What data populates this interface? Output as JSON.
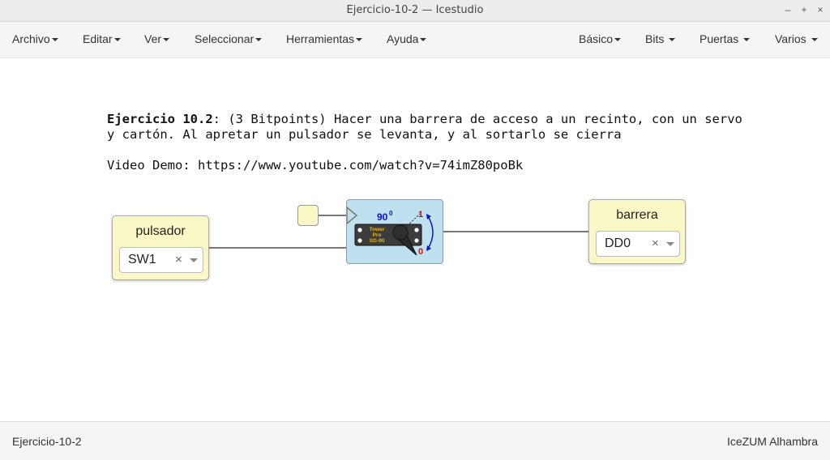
{
  "window": {
    "title": "Ejercicio-10-2 — Icestudio"
  },
  "menu": {
    "left": [
      "Archivo",
      "Editar",
      "Ver",
      "Seleccionar",
      "Herramientas",
      "Ayuda"
    ],
    "right": [
      "Básico",
      "Bits",
      "Puertas",
      "Varios"
    ]
  },
  "info": {
    "title_bold": "Ejercicio 10.2",
    "title_rest": ": (3 Bitpoints) Hacer una barrera de acceso a un recinto, con un servo\ny cartón. Al apretar un pulsador se levanta, y al sortarlo se cierra",
    "video": "Video Demo: https://www.youtube.com/watch?v=74imZ80poBk"
  },
  "blocks": {
    "input": {
      "label": "pulsador",
      "pin": "SW1"
    },
    "output": {
      "label": "barrera",
      "pin": "DD0"
    }
  },
  "servo": {
    "angle": "90",
    "degree_sign": "0",
    "high": "1",
    "low": "0",
    "brand_lines": [
      "Tower",
      "Pro",
      "SG-90"
    ]
  },
  "statusbar": {
    "left": "Ejercicio-10-2",
    "right": "IceZUM Alhambra"
  },
  "colors": {
    "block_bg": "#fbf8c8",
    "servo_bg": "#bfe0ee",
    "wire": "#777777",
    "angle_blue": "#1010cc",
    "red": "#ee0000",
    "brand_yellow": "#e8b800"
  },
  "icons": {
    "minimize": "minimize-icon",
    "maximize": "maximize-icon",
    "close": "close-icon",
    "clear": "clear-x-icon",
    "dropdown": "dropdown-caret-icon"
  }
}
